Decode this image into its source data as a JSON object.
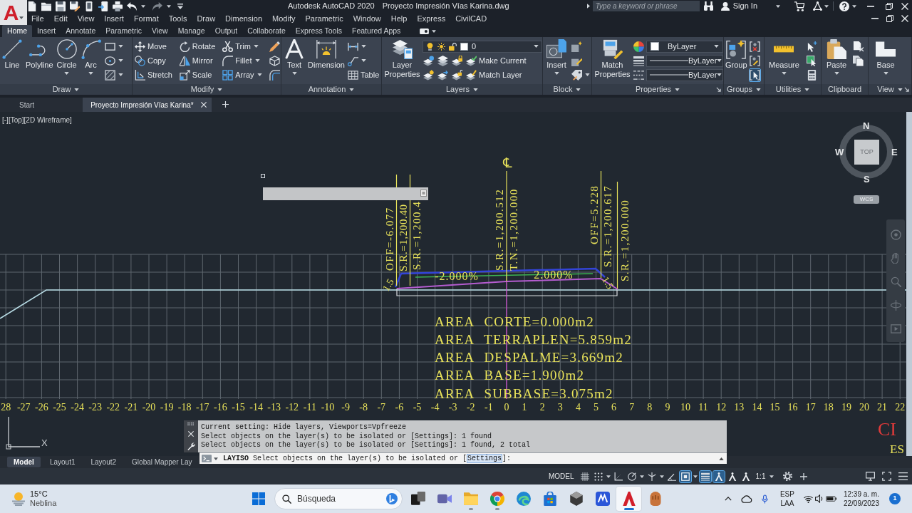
{
  "title_bar": {
    "app_menu": "A",
    "title": "Autodesk AutoCAD 2020",
    "document": "Proyecto Impresión Vías Karina.dwg",
    "search": {
      "placeholder": "Type a keyword or phrase"
    },
    "sign_in": "Sign In"
  },
  "menu_bar": [
    "File",
    "Edit",
    "View",
    "Insert",
    "Format",
    "Tools",
    "Draw",
    "Dimension",
    "Modify",
    "Parametric",
    "Window",
    "Help",
    "Express",
    "CivilCAD"
  ],
  "ribbon_tabs": [
    {
      "label": "Home",
      "selected": true
    },
    {
      "label": "Insert",
      "selected": false
    },
    {
      "label": "Annotate",
      "selected": false
    },
    {
      "label": "Parametric",
      "selected": false
    },
    {
      "label": "View",
      "selected": false
    },
    {
      "label": "Manage",
      "selected": false
    },
    {
      "label": "Output",
      "selected": false
    },
    {
      "label": "Collaborate",
      "selected": false
    },
    {
      "label": "Express Tools",
      "selected": false
    },
    {
      "label": "Featured Apps",
      "selected": false
    }
  ],
  "ribbon_panels": [
    {
      "title": "Draw",
      "dropdown": true,
      "launcher": false,
      "columns": [
        [
          [
            {
              "kind": "large",
              "label": "Line",
              "dropdown": false
            }
          ]
        ],
        [
          [
            {
              "kind": "large",
              "label": "Polyline",
              "dropdown": false
            }
          ]
        ],
        [
          [
            {
              "kind": "large",
              "label": "Circle",
              "dropdown": true
            }
          ]
        ],
        [
          [
            {
              "kind": "large",
              "label": "Arc",
              "dropdown": true
            }
          ]
        ],
        [
          [
            {
              "kind": "small",
              "dropdown": true
            }
          ],
          [
            {
              "kind": "small",
              "dropdown": true
            }
          ],
          [
            {
              "kind": "small",
              "dropdown": true
            }
          ]
        ]
      ]
    },
    {
      "title": "Modify",
      "dropdown": true,
      "launcher": false,
      "columns": [
        [
          [
            {
              "kind": "small",
              "label": "Move",
              "dropdown": false
            }
          ],
          [
            {
              "kind": "small",
              "label": "Copy",
              "dropdown": false
            }
          ],
          [
            {
              "kind": "small",
              "label": "Stretch",
              "dropdown": false
            }
          ]
        ],
        [
          [
            {
              "kind": "small",
              "label": "Rotate",
              "dropdown": false
            }
          ],
          [
            {
              "kind": "small",
              "label": "Mirror",
              "dropdown": false
            }
          ],
          [
            {
              "kind": "small",
              "label": "Scale",
              "dropdown": false
            }
          ]
        ],
        [
          [
            {
              "kind": "small",
              "label": "Trim",
              "dropdown": true
            }
          ],
          [
            {
              "kind": "small",
              "label": "Fillet",
              "dropdown": true
            }
          ],
          [
            {
              "kind": "small",
              "label": "Array",
              "dropdown": true
            }
          ]
        ],
        [
          [
            {
              "kind": "small",
              "dropdown": false
            }
          ],
          [
            {
              "kind": "small",
              "dropdown": false
            }
          ],
          [
            {
              "kind": "small",
              "dropdown": false
            }
          ]
        ]
      ]
    },
    {
      "title": "Annotation",
      "dropdown": true,
      "launcher": false,
      "columns": [
        [
          [
            {
              "kind": "large",
              "label": "Text",
              "dropdown": true
            }
          ]
        ],
        [
          [
            {
              "kind": "large",
              "label": "Dimension",
              "dropdown": false
            }
          ]
        ],
        [
          [
            {
              "kind": "small",
              "dropdown": true
            }
          ],
          [
            {
              "kind": "small",
              "dropdown": true
            }
          ],
          [
            {
              "kind": "small",
              "label": "Table",
              "dropdown": false
            }
          ]
        ]
      ]
    },
    {
      "title": "Layers",
      "dropdown": true,
      "launcher": false,
      "columns": [
        [
          [
            {
              "kind": "large",
              "label": "Layer Properties",
              "dropdown": false
            }
          ]
        ],
        [
          [
            {
              "kind": "layer_combo",
              "value": "0"
            }
          ],
          [
            {
              "kind": "small",
              "dropdown": false
            },
            {
              "kind": "small",
              "dropdown": false
            },
            {
              "kind": "small",
              "dropdown": false
            },
            {
              "kind": "small",
              "label": "Make Current",
              "dropdown": false
            }
          ],
          [
            {
              "kind": "small",
              "dropdown": false
            },
            {
              "kind": "small",
              "dropdown": false
            },
            {
              "kind": "small",
              "dropdown": false
            },
            {
              "kind": "small",
              "label": "Match Layer",
              "dropdown": false
            }
          ]
        ]
      ]
    },
    {
      "title": "Block",
      "dropdown": true,
      "launcher": false,
      "columns": [
        [
          [
            {
              "kind": "large",
              "label": "Insert",
              "dropdown": true
            }
          ]
        ],
        [
          [
            {
              "kind": "small",
              "dropdown": false
            }
          ],
          [
            {
              "kind": "small",
              "dropdown": false
            }
          ],
          [
            {
              "kind": "small",
              "dropdown": true
            }
          ]
        ]
      ]
    },
    {
      "title": "Properties",
      "dropdown": true,
      "launcher": true,
      "columns": [
        [
          [
            {
              "kind": "large",
              "label": "Match Properties",
              "dropdown": false
            }
          ]
        ],
        [
          [
            {
              "kind": "small",
              "dropdown": false
            }
          ],
          [
            {
              "kind": "small",
              "dropdown": false
            }
          ],
          [
            {
              "kind": "small",
              "dropdown": false
            }
          ]
        ],
        [
          [
            {
              "kind": "color_combo",
              "value": "ByLayer"
            }
          ],
          [
            {
              "kind": "line_combo",
              "value": "ByLayer"
            }
          ],
          [
            {
              "kind": "line_combo",
              "value": "ByLayer"
            }
          ]
        ]
      ]
    },
    {
      "title": "Groups",
      "dropdown": true,
      "launcher": false,
      "columns": [
        [
          [
            {
              "kind": "large",
              "label": "Group",
              "dropdown": false
            }
          ]
        ],
        [
          [
            {
              "kind": "small",
              "dropdown": false,
              "on": false
            }
          ],
          [
            {
              "kind": "small",
              "dropdown": false,
              "on": false
            }
          ],
          [
            {
              "kind": "small",
              "dropdown": false,
              "on": true
            }
          ]
        ]
      ]
    },
    {
      "title": "Utilities",
      "dropdown": true,
      "launcher": false,
      "columns": [
        [
          [
            {
              "kind": "large",
              "label": "Measure",
              "dropdown": true
            }
          ]
        ],
        [
          [
            {
              "kind": "small",
              "dropdown": false
            }
          ],
          [
            {
              "kind": "small",
              "dropdown": false
            }
          ],
          [
            {
              "kind": "small",
              "dropdown": false
            }
          ]
        ]
      ]
    },
    {
      "title": "Clipboard",
      "dropdown": false,
      "launcher": false,
      "columns": [
        [
          [
            {
              "kind": "large",
              "label": "Paste",
              "dropdown": true
            }
          ]
        ],
        [
          [
            {
              "kind": "small",
              "dropdown": false
            }
          ],
          [
            {
              "kind": "small",
              "dropdown": false
            }
          ]
        ]
      ]
    },
    {
      "title": "View",
      "dropdown": true,
      "launcher": true,
      "columns": [
        [
          [
            {
              "kind": "large",
              "label": "Base",
              "dropdown": true
            }
          ]
        ]
      ]
    }
  ],
  "file_tabs": [
    {
      "label": "Start",
      "selected": false
    },
    {
      "label": "Proyecto Impresión Vías Karina*",
      "selected": true
    }
  ],
  "viewport_controls": [
    "[-]",
    "[Top]",
    "[2D Wireframe]"
  ],
  "drawing": {
    "centerline_mark": "℄",
    "vertical_labels": [
      "OFF=-6.077",
      "S.R.=1,200.40",
      "S.R.=1,200.4",
      "S.R.=1,200.512",
      "T.N.=1,200.000",
      "OFF=5.228",
      "S.R.=1,200.617",
      "S.R.=1,200.000"
    ],
    "grades": [
      "-2.000%",
      "2.000%"
    ],
    "slopes": [
      "1.5",
      "1.5"
    ],
    "areas": [
      "AREA CORTE=0.000m2",
      "AREA TERRAPLEN=5.859m2",
      "AREA DESPALME=3.669m2",
      "AREA BASE=1.900m2",
      "AREA SUBBASE=3.075m2"
    ],
    "axis_numbers": [
      "28",
      "-27",
      "-26",
      "-25",
      "-24",
      "-23",
      "-22",
      "-21",
      "-20",
      "-19",
      "-18",
      "-17",
      "-16",
      "-15",
      "-14",
      "-13",
      "-12",
      "-11",
      "-10",
      "-9",
      "-8",
      "-7",
      "-6",
      "-5",
      "-4",
      "-3",
      "-2",
      "-1",
      "0",
      "1",
      "2",
      "3",
      "4",
      "5",
      "6",
      "7",
      "8",
      "9",
      "10",
      "11",
      "12",
      "13",
      "14",
      "15",
      "16",
      "17",
      "18",
      "19",
      "20",
      "21",
      "22"
    ],
    "edge_texts": [
      {
        "text": "CI",
        "color": "#e03a3a"
      },
      {
        "text": "ES",
        "color": "#e8e25a"
      }
    ]
  },
  "viewcube": {
    "top": "TOP",
    "north": "N",
    "south": "S",
    "east": "E",
    "west": "W",
    "ucs": "WCS"
  },
  "ucs_icon": {
    "x_label": "X"
  },
  "command_line": {
    "history": [
      "Current setting: Hide layers, Viewports=Vpfreeze",
      "Select objects on the layer(s) to be isolated or [Settings]: 1 found",
      "Select objects on the layer(s) to be isolated or [Settings]: 1 found, 2 total"
    ],
    "command": "LAYISO",
    "prompt": "Select objects on the layer(s) to be isolated or [",
    "option": "Settings",
    "prompt_end": "]:"
  },
  "layout_tabs": [
    {
      "label": "Model",
      "selected": true
    },
    {
      "label": "Layout1",
      "selected": false
    },
    {
      "label": "Layout2",
      "selected": false
    },
    {
      "label": "Global Mapper Lay",
      "selected": false
    }
  ],
  "status_bar": {
    "space": "MODEL",
    "toggles": [
      {
        "on": false,
        "dropdown": false
      },
      {
        "on": false,
        "dropdown": true
      },
      {
        "on": false,
        "dropdown": false
      },
      {
        "on": false,
        "dropdown": true
      },
      {
        "on": false,
        "dropdown": true
      },
      {
        "on": false,
        "dropdown": false
      },
      {
        "on": true,
        "dropdown": true
      },
      {
        "on": true,
        "dropdown": false
      },
      {
        "on": true,
        "dropdown": false
      },
      {
        "on": false,
        "dropdown": false
      },
      {
        "on": false,
        "dropdown": false
      }
    ],
    "scale": "1:1"
  },
  "taskbar": {
    "weather": {
      "temperature": "15°C",
      "condition": "Neblina"
    },
    "search": {
      "placeholder": "Búsqueda"
    },
    "apps": [
      {
        "running": false,
        "active": false
      },
      {
        "running": false,
        "active": false
      },
      {
        "running": true,
        "active": false
      },
      {
        "running": true,
        "active": false
      },
      {
        "running": false,
        "active": false
      },
      {
        "running": false,
        "active": false
      },
      {
        "running": false,
        "active": false
      },
      {
        "running": false,
        "active": false
      },
      {
        "running": true,
        "active": true
      },
      {
        "running": false,
        "active": false
      }
    ],
    "tray": {
      "language": "ESP",
      "layout": "LAA",
      "time": "12:39 a. m.",
      "date": "22/09/2023",
      "notifications": "1"
    }
  }
}
